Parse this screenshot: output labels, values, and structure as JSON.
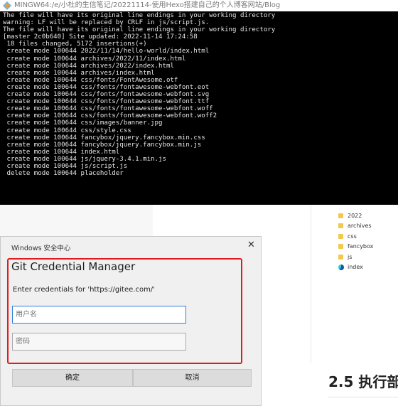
{
  "terminal": {
    "title": "MINGW64:/e/小杜的生信笔记/20221114-使用Hexo搭建自己的个人博客网站/Blog",
    "lines": [
      "The file will have its original line endings in your working directory",
      "warning: LF will be replaced by CRLF in js/script.js.",
      "The file will have its original line endings in your working directory",
      "[master 2c0b640] Site updated: 2022-11-14 17:24:58",
      " 18 files changed, 5172 insertions(+)",
      " create mode 100644 2022/11/14/hello-world/index.html",
      " create mode 100644 archives/2022/11/index.html",
      " create mode 100644 archives/2022/index.html",
      " create mode 100644 archives/index.html",
      " create mode 100644 css/fonts/FontAwesome.otf",
      " create mode 100644 css/fonts/fontawesome-webfont.eot",
      " create mode 100644 css/fonts/fontawesome-webfont.svg",
      " create mode 100644 css/fonts/fontawesome-webfont.ttf",
      " create mode 100644 css/fonts/fontawesome-webfont.woff",
      " create mode 100644 css/fonts/fontawesome-webfont.woff2",
      " create mode 100644 css/images/banner.jpg",
      " create mode 100644 css/style.css",
      " create mode 100644 fancybox/jquery.fancybox.min.css",
      " create mode 100644 fancybox/jquery.fancybox.min.js",
      " create mode 100644 index.html",
      " create mode 100644 js/jquery-3.4.1.min.js",
      " create mode 100644 js/script.js",
      " delete mode 100644 placeholder"
    ]
  },
  "files": [
    {
      "name": "2022",
      "icon": "folder-icon"
    },
    {
      "name": "archives",
      "icon": "folder-icon"
    },
    {
      "name": "css",
      "icon": "folder-icon"
    },
    {
      "name": "fancybox",
      "icon": "folder-icon"
    },
    {
      "name": "js",
      "icon": "folder-icon"
    },
    {
      "name": "index",
      "icon": "edge-browser-icon"
    }
  ],
  "page": {
    "heading": "2.5 执行部"
  },
  "dialog": {
    "window_title": "Windows 安全中心",
    "close": "✕",
    "app_title": "Git Credential Manager",
    "prompt": "Enter credentials for 'https://gitee.com/'",
    "username_placeholder": "用户名",
    "password_placeholder": "密码",
    "ok_label": "确定",
    "cancel_label": "取消",
    "highlight_color": "#e2191d"
  }
}
